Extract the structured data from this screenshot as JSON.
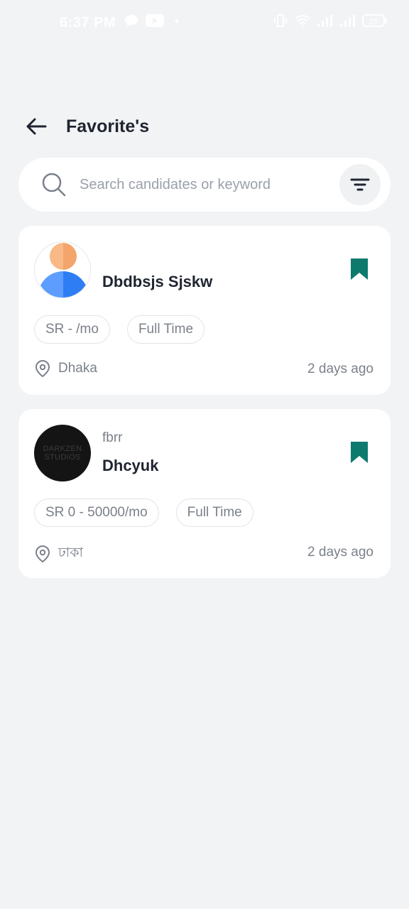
{
  "status_bar": {
    "time": "6:37 PM",
    "icons": [
      "chat-bubble-icon",
      "youtube-icon",
      "dot-icon",
      "vibrate-icon",
      "wifi-icon",
      "signal-icon",
      "signal-icon-2",
      "battery-icon"
    ],
    "battery": "25"
  },
  "header": {
    "title": "Favorite's"
  },
  "search": {
    "placeholder": "Search candidates or keyword"
  },
  "candidates": [
    {
      "subtitle": "",
      "name": "Dbdbsjs Sjskw",
      "salary": "SR  - /mo",
      "job_type": "Full Time",
      "location": "Dhaka",
      "posted": "2 days ago",
      "avatar": "default-person-avatar"
    },
    {
      "subtitle": "fbrr",
      "name": "Dhcyuk",
      "salary": "SR 0 - 50000/mo",
      "job_type": "Full Time",
      "location": "ঢাকা",
      "posted": "2 days ago",
      "avatar": "darkzen-studios-logo",
      "avatar_text": [
        "DARKZEN",
        "STUDIOS"
      ]
    }
  ],
  "colors": {
    "background": "#f2f3f5",
    "card": "#ffffff",
    "bookmark": "#0e7a6e",
    "text_primary": "#1f2430",
    "text_secondary": "#7b808a"
  }
}
